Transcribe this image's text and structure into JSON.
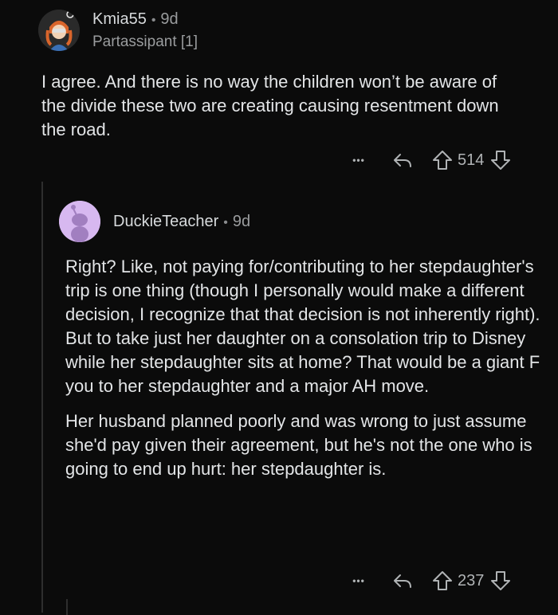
{
  "comments": [
    {
      "username": "Kmia55",
      "separator": "•",
      "age": "9d",
      "flair": "Partassipant [1]",
      "paragraphs": [
        "I agree. And there is no way the children won’t be aware of the divide these two are creating causing resentment down the road."
      ],
      "more": "•••",
      "score": "514"
    },
    {
      "username": "DuckieTeacher",
      "separator": "•",
      "age": "9d",
      "paragraphs": [
        "Right? Like, not paying for/contributing to her stepdaughter's trip is one thing (though I personally would make a different decision, I recognize that that decision is not inherently right). But to take just her daughter on a consolation trip to Disney while her stepdaughter sits at home? That would be a giant F you to her stepdaughter and a major AH move.",
        "Her husband planned poorly and was wrong to just assume she'd pay given their agreement, but he's not the one who is going to end up hurt: her stepdaughter is."
      ],
      "more": "•••",
      "score": "237"
    }
  ],
  "icons": {
    "reply": "reply-arrow-icon",
    "upvote": "upvote-arrow-icon",
    "downvote": "downvote-arrow-icon",
    "more": "more-options-icon"
  }
}
